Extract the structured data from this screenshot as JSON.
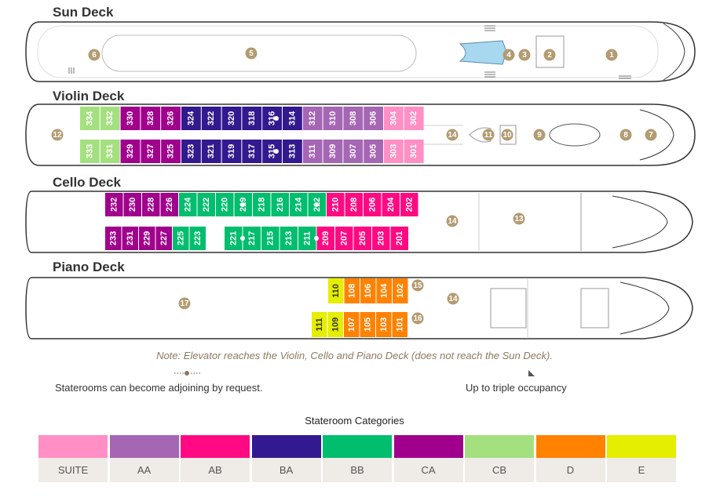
{
  "decks": {
    "sun": {
      "title": "Sun Deck"
    },
    "violin": {
      "title": "Violin Deck"
    },
    "cello": {
      "title": "Cello Deck"
    },
    "piano": {
      "title": "Piano Deck"
    }
  },
  "colors": {
    "SUITE": "#ff8fc4",
    "AA": "#a566b4",
    "AB": "#ff0a82",
    "BA": "#33198f",
    "BB": "#00be6e",
    "CA": "#a0008c",
    "CB": "#a5e080",
    "D": "#ff8200",
    "E": "#e6ee00",
    "poi": "#b39b72",
    "hull": "#333333"
  },
  "cabins": {
    "violin_top": [
      {
        "num": "334",
        "cat": "CB"
      },
      {
        "num": "332",
        "cat": "CB"
      },
      {
        "num": "330",
        "cat": "CA"
      },
      {
        "num": "328",
        "cat": "CA"
      },
      {
        "num": "326",
        "cat": "CA"
      },
      {
        "num": "324",
        "cat": "BA"
      },
      {
        "num": "322",
        "cat": "BA"
      },
      {
        "num": "320",
        "cat": "BA"
      },
      {
        "num": "318",
        "cat": "BA"
      },
      {
        "num": "316",
        "cat": "BA"
      },
      {
        "num": "314",
        "cat": "BA"
      },
      {
        "num": "312",
        "cat": "AA"
      },
      {
        "num": "310",
        "cat": "AA"
      },
      {
        "num": "308",
        "cat": "AA"
      },
      {
        "num": "306",
        "cat": "AA"
      },
      {
        "num": "304",
        "cat": "SUITE"
      },
      {
        "num": "302",
        "cat": "SUITE"
      }
    ],
    "violin_bottom": [
      {
        "num": "333",
        "cat": "CB"
      },
      {
        "num": "331",
        "cat": "CB"
      },
      {
        "num": "329",
        "cat": "CA"
      },
      {
        "num": "327",
        "cat": "CA"
      },
      {
        "num": "325",
        "cat": "CA"
      },
      {
        "num": "323",
        "cat": "BA"
      },
      {
        "num": "321",
        "cat": "BA"
      },
      {
        "num": "319",
        "cat": "BA"
      },
      {
        "num": "317",
        "cat": "BA"
      },
      {
        "num": "315",
        "cat": "BA"
      },
      {
        "num": "313",
        "cat": "BA"
      },
      {
        "num": "311",
        "cat": "AA"
      },
      {
        "num": "309",
        "cat": "AA"
      },
      {
        "num": "307",
        "cat": "AA"
      },
      {
        "num": "305",
        "cat": "AA"
      },
      {
        "num": "303",
        "cat": "SUITE"
      },
      {
        "num": "301",
        "cat": "SUITE"
      }
    ],
    "cello_top": [
      {
        "num": "232",
        "cat": "CA"
      },
      {
        "num": "230",
        "cat": "CA"
      },
      {
        "num": "228",
        "cat": "CA"
      },
      {
        "num": "226",
        "cat": "CA"
      },
      {
        "num": "224",
        "cat": "BB"
      },
      {
        "num": "222",
        "cat": "BB"
      },
      {
        "num": "220",
        "cat": "BB"
      },
      {
        "num": "219",
        "cat": "BB"
      },
      {
        "num": "218",
        "cat": "BB"
      },
      {
        "num": "216",
        "cat": "BB"
      },
      {
        "num": "214",
        "cat": "BB"
      },
      {
        "num": "212",
        "cat": "BB"
      },
      {
        "num": "210",
        "cat": "AB"
      },
      {
        "num": "208",
        "cat": "AB"
      },
      {
        "num": "206",
        "cat": "AB"
      },
      {
        "num": "204",
        "cat": "AB"
      },
      {
        "num": "202",
        "cat": "AB"
      }
    ],
    "cello_bottom": [
      {
        "num": "233",
        "cat": "CA"
      },
      {
        "num": "231",
        "cat": "CA"
      },
      {
        "num": "229",
        "cat": "CA"
      },
      {
        "num": "227",
        "cat": "CA"
      },
      {
        "num": "225",
        "cat": "BB"
      },
      {
        "num": "223",
        "cat": "BB"
      },
      {
        "num": "221",
        "cat": "BB"
      },
      {
        "num": "217",
        "cat": "BB"
      },
      {
        "num": "215",
        "cat": "BB"
      },
      {
        "num": "213",
        "cat": "BB"
      },
      {
        "num": "211",
        "cat": "BB"
      },
      {
        "num": "209",
        "cat": "AB"
      },
      {
        "num": "207",
        "cat": "AB"
      },
      {
        "num": "205",
        "cat": "AB"
      },
      {
        "num": "203",
        "cat": "AB"
      },
      {
        "num": "201",
        "cat": "AB"
      }
    ],
    "piano_top": [
      {
        "num": "110",
        "cat": "E"
      },
      {
        "num": "108",
        "cat": "D"
      },
      {
        "num": "106",
        "cat": "D"
      },
      {
        "num": "104",
        "cat": "D"
      },
      {
        "num": "102",
        "cat": "D"
      }
    ],
    "piano_bottom": [
      {
        "num": "111",
        "cat": "E"
      },
      {
        "num": "109",
        "cat": "E"
      },
      {
        "num": "107",
        "cat": "D"
      },
      {
        "num": "105",
        "cat": "D"
      },
      {
        "num": "103",
        "cat": "D"
      },
      {
        "num": "101",
        "cat": "D"
      }
    ]
  },
  "poi": {
    "sun": [
      "6",
      "5",
      "4",
      "3",
      "2",
      "1"
    ],
    "violin": [
      "12",
      "14",
      "11",
      "10",
      "9",
      "8",
      "7"
    ],
    "cello": [
      "14",
      "13"
    ],
    "piano": [
      "17",
      "15",
      "16",
      "14"
    ]
  },
  "note": "Note: Elevator reaches the Violin, Cello and Piano Deck (does not reach the Sun Deck).",
  "legend": {
    "adjoining": "Staterooms can become adjoining by request.",
    "triple": "Up to triple occupancy"
  },
  "categories_title": "Stateroom Categories",
  "categories": [
    {
      "code": "SUITE",
      "label": "SUITE"
    },
    {
      "code": "AA",
      "label": "AA"
    },
    {
      "code": "AB",
      "label": "AB"
    },
    {
      "code": "BA",
      "label": "BA"
    },
    {
      "code": "BB",
      "label": "BB"
    },
    {
      "code": "CA",
      "label": "CA"
    },
    {
      "code": "CB",
      "label": "CB"
    },
    {
      "code": "D",
      "label": "D"
    },
    {
      "code": "E",
      "label": "E"
    }
  ]
}
